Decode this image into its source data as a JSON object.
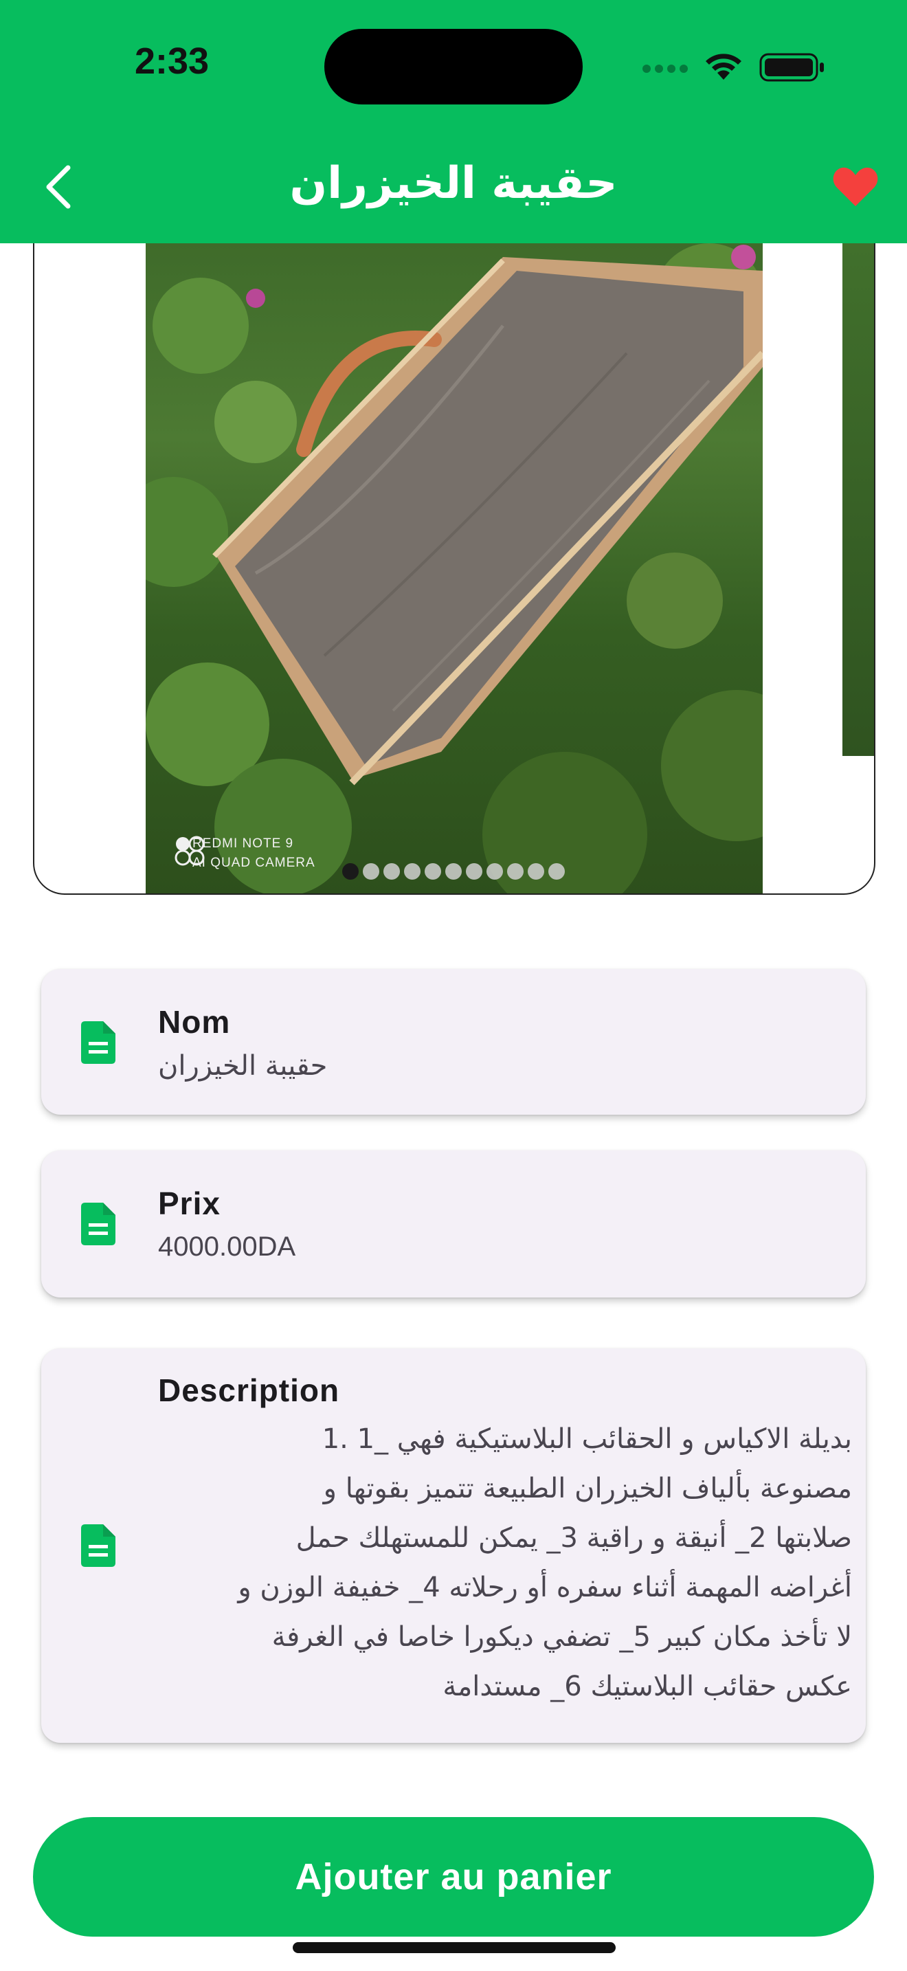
{
  "status_bar": {
    "time": "2:33"
  },
  "app_bar": {
    "title": "حقيبة الخيزران"
  },
  "carousel": {
    "watermark_line1": "REDMI NOTE 9",
    "watermark_line2": "AI QUAD CAMERA",
    "page_count": 11,
    "active_page": 0
  },
  "details": {
    "name": {
      "label": "Nom",
      "value": "حقيبة الخيزران"
    },
    "price": {
      "label": "Prix",
      "value": "4000.00DA"
    },
    "description": {
      "label": "Description",
      "lines": [
        "بديلة الاكياس و الحقائب البلاستيكية  فهي _1 .1",
        "مصنوعة بألياف الخيزران الطبيعة تتميز بقوتها و",
        "صلابتها 2_ أنيقة و راقية 3_ يمكن للمستهلك حمل",
        "أغراضه المهمة أثناء سفره أو رحلاته  4_ خفيفة الوزن و",
        "لا تأخذ مكان كبير 5_ تضفي ديكورا خاصا في الغرفة",
        "عكس حقائب البلاستيك 6_ مستدامة"
      ]
    }
  },
  "actions": {
    "add_to_cart": "Ajouter au panier"
  },
  "colors": {
    "primary": "#07bd5e",
    "favorite": "#f4403d",
    "card_bg": "#f4f0f7"
  }
}
